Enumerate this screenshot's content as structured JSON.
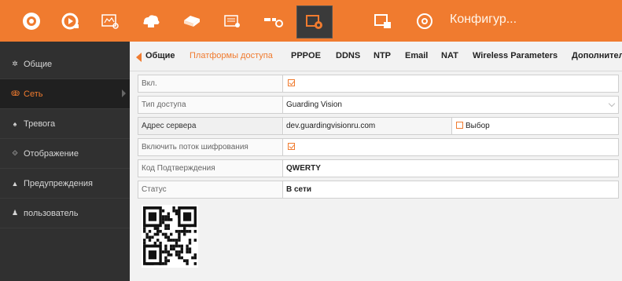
{
  "toolbar": {
    "title": "Конфигур...",
    "buttons": [
      {
        "icon": "live-view-icon"
      },
      {
        "icon": "playback-icon"
      },
      {
        "icon": "picture-icon"
      },
      {
        "icon": "cloud-camera-icon"
      },
      {
        "icon": "backup-icon"
      },
      {
        "icon": "maintenance-icon"
      },
      {
        "icon": "search-settings-icon"
      },
      {
        "icon": "configuration-icon"
      },
      {
        "icon": "manage-icon"
      },
      {
        "icon": "shutdown-icon"
      }
    ],
    "accent_color": "#f07b2f"
  },
  "sidebar": {
    "items": [
      {
        "label": "Общие",
        "icon": "gear-icon"
      },
      {
        "label": "Сеть",
        "icon": "network-icon"
      },
      {
        "label": "Тревога",
        "icon": "alarm-icon"
      },
      {
        "label": "Отображение",
        "icon": "display-icon"
      },
      {
        "label": "Предупреждения",
        "icon": "warning-icon"
      },
      {
        "label": "пользователь",
        "icon": "user-icon"
      }
    ],
    "active_index": 1
  },
  "tabs": {
    "items": [
      "Общие",
      "Платформы доступа",
      "PPPOE",
      "DDNS",
      "NTP",
      "Email",
      "NAT",
      "Wireless Parameters",
      "Дополнител"
    ],
    "active_index": 1
  },
  "form": {
    "enable_label": "Вкл.",
    "enable_checked": true,
    "access_type_label": "Тип доступа",
    "access_type_value": "Guarding Vision",
    "server_address_label": "Адрес сервера",
    "server_address_value": "dev.guardingvisionru.com",
    "custom_label": "Выбор",
    "custom_checked": false,
    "encryption_label": "Включить поток шифрования",
    "encryption_checked": true,
    "verification_code_label": "Код Подтверждения",
    "verification_code_value": "QWERTY",
    "status_label": "Статус",
    "status_value": "В сети"
  }
}
